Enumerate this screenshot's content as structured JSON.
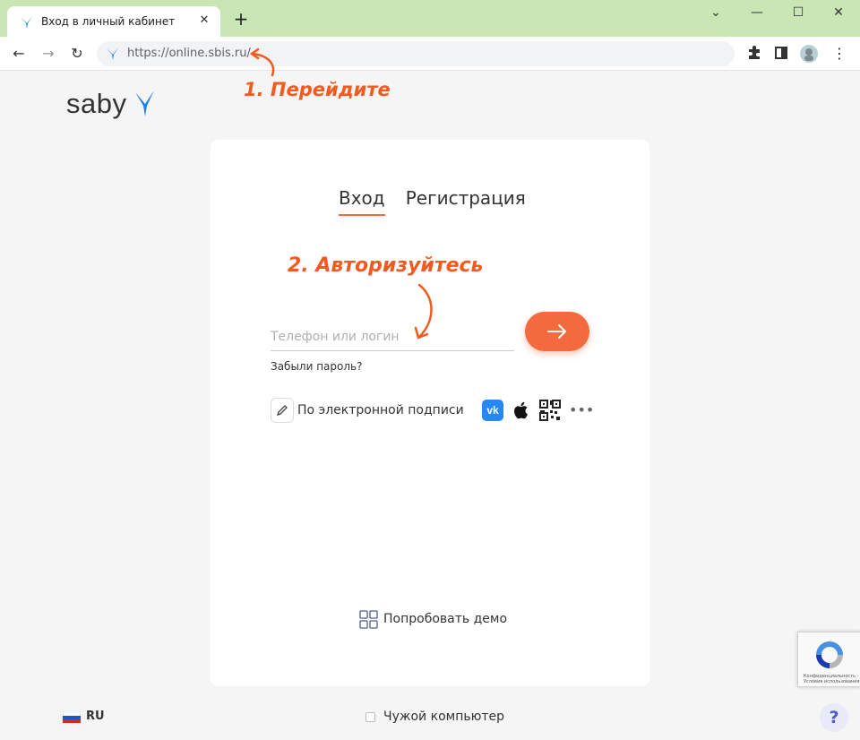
{
  "browser": {
    "tab_title": "Вход в личный кабинет",
    "tab_close": "✕",
    "new_tab": "+",
    "window_controls": {
      "collapse": "⌄",
      "minimize": "—",
      "maximize": "☐",
      "close": "✕"
    },
    "url": "https://online.sbis.ru/",
    "nav": {
      "back": "←",
      "forward": "→",
      "reload": "↻"
    },
    "toolbar_icons": [
      "puzzle-icon",
      "side-panel-icon",
      "avatar",
      "kebab-menu-icon"
    ],
    "menu": "⋮",
    "theme_color": "#c9e6b5"
  },
  "logo": {
    "text": "saby",
    "accent_color": "#1e7ff0"
  },
  "auth": {
    "tabs": [
      {
        "label": "Вход",
        "active": true
      },
      {
        "label": "Регистрация",
        "active": false
      }
    ],
    "login_placeholder": "Телефон или логин",
    "login_value": "",
    "forgot_password": "Забыли пароль?",
    "esign_label": "По электронной подписи",
    "social": {
      "vk": "vk",
      "apple": "apple-icon",
      "qr": "qr-code-icon",
      "more": "•••"
    },
    "demo_label": "Попробовать демо",
    "accent_color": "#f26a3d"
  },
  "annotations": {
    "step1": "1. Перейдите",
    "step2": "2. Авторизуйтесь",
    "color": "#f45a1f"
  },
  "footer": {
    "language": "RU",
    "foreign_computer": "Чужой компьютер",
    "foreign_checked": false,
    "help": "?"
  },
  "recaptcha": {
    "text_line1": "Конфиденциальность -",
    "text_line2": "Условия использования"
  }
}
